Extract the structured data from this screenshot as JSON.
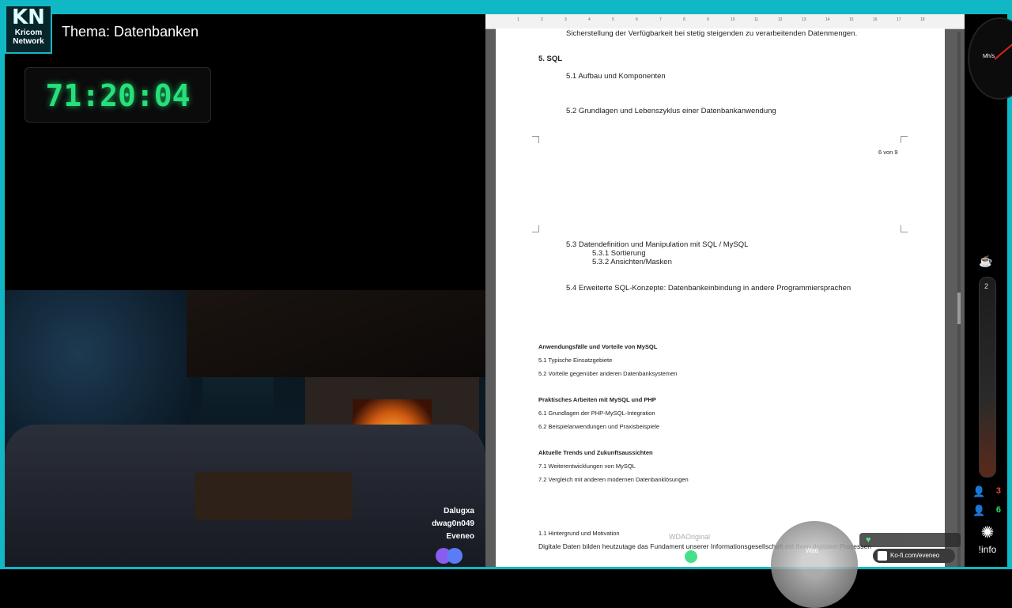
{
  "stream": {
    "logo_title": "KN",
    "logo_sub": "Kricom\nNetwork",
    "logo_sub1": "Kricom",
    "logo_sub2": "Network",
    "topic": "Thema: Datenbanken",
    "timer": "71:20:04",
    "viewers": [
      "Dalugxa",
      "dwag0n049",
      "Eveneo"
    ]
  },
  "ruler": {
    "ticks": [
      "1",
      "2",
      "3",
      "4",
      "5",
      "6",
      "7",
      "8",
      "9",
      "10",
      "11",
      "12",
      "13",
      "14",
      "15",
      "16",
      "17",
      "18"
    ]
  },
  "document": {
    "page1": {
      "top_line": "Sicherstellung der Verfügbarkeit bei stetig steigenden zu verarbeitenden Datenmengen.",
      "heading": "5. SQL",
      "item1": "5.1 Aufbau und Komponenten",
      "item2": "5.2 Grundlagen und Lebenszyklus einer Datenbankanwendung",
      "page_number": "6 von 9"
    },
    "page2": {
      "item3": "5.3 Datendefinition und Manipulation mit SQL / MySQL",
      "item3_1": "5.3.1 Sortierung",
      "item3_2": "5.3.2 Ansichten/Masken",
      "item4": "5.4 Erweiterte SQL-Konzepte: Datenbankeinbindung in andere Programmiersprachen",
      "sec1_title": "Anwendungsfälle und Vorteile von MySQL",
      "sec1_a": "5.1 Typische Einsatzgebiete",
      "sec1_b": "5.2 Vorteile gegenüber anderen Datenbanksystemen",
      "sec2_title": "Praktisches Arbeiten mit MySQL und PHP",
      "sec2_a": "6.1 Grundlagen der PHP-MySQL-Integration",
      "sec2_b": "6.2 Beispielanwendungen und Praxisbeispiele",
      "sec3_title": "Aktuelle Trends und Zukunftsaussichten",
      "sec3_a": "7.1 Weiterentwicklungen von MySQL",
      "sec3_b": "7.2 Vergleich mit anderen modernen Datenbanklösungen",
      "sec4_a": "1.1 Hintergrund und Motivation",
      "sec4_body": "Digitale Daten bilden heutzutage das Fundament unserer Informationsgesellschaft mit ihren digitalen Prozessen"
    }
  },
  "overlay": {
    "watermark": "WDAOriginal",
    "gauge_label": "Watt",
    "kofi": "Ko-fi.com/eveneo",
    "speedo_label": "Mh/s",
    "tube_level": "2",
    "count_a": "3",
    "count_b": "6",
    "info_label": "!info"
  },
  "colors": {
    "frame": "#0fb8c4",
    "timer": "#27e07a",
    "count_a": "#e84a4a",
    "count_b": "#2fdc6e"
  }
}
